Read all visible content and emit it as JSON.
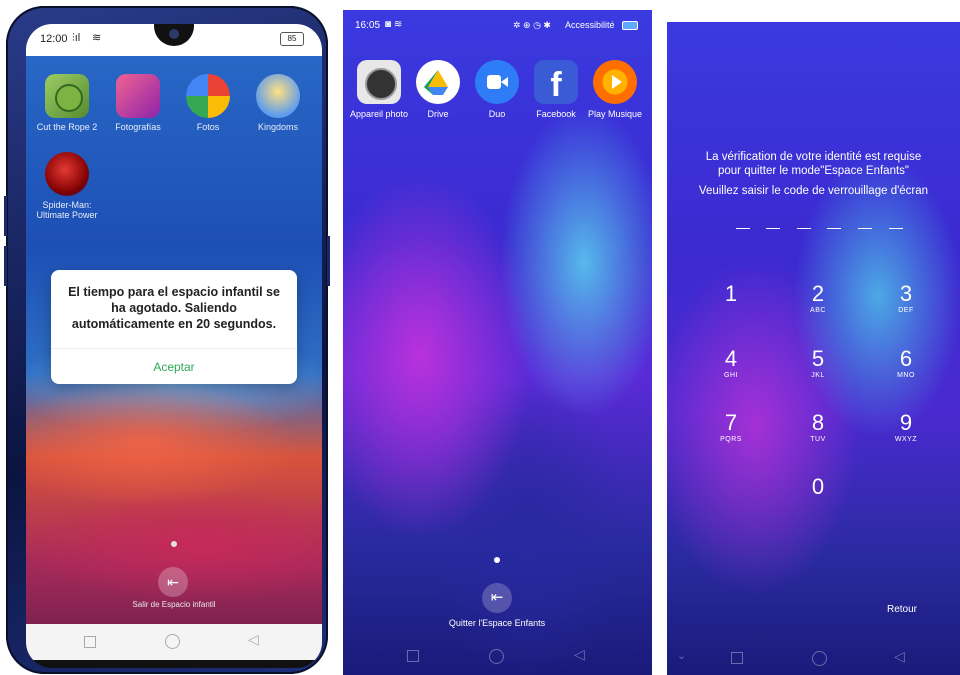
{
  "screen1": {
    "status_time": "12:00",
    "battery": "85",
    "apps": [
      {
        "label": "Cut the Rope 2",
        "icon": "cut-the-rope-2-icon",
        "color": "#8bc34a"
      },
      {
        "label": "Fotografías",
        "icon": "photos-gallery-icon",
        "color": "#d94a8c"
      },
      {
        "label": "Fotos",
        "icon": "google-photos-icon",
        "color": "#f2f2f2"
      },
      {
        "label": "Kingdoms",
        "icon": "kingdoms-icon",
        "color": "#e0c35a"
      },
      {
        "label": "Spider-Man: Ultimate Power",
        "icon": "spiderman-icon",
        "color": "#b71c1c"
      }
    ],
    "dialog": {
      "message": "El tiempo para el espacio infantil se ha agotado. Saliendo automáticamente en 20 segundos.",
      "button": "Aceptar"
    },
    "exit_label": "Salir de Espacio infantil",
    "accent": "#2fa85a"
  },
  "screen2": {
    "status_time": "16:05",
    "status_right": "Accessibilité",
    "apps": [
      {
        "label": "Appareil photo",
        "icon": "camera-icon",
        "color": "#e0e0e0"
      },
      {
        "label": "Drive",
        "icon": "google-drive-icon",
        "color": "#ffffff"
      },
      {
        "label": "Duo",
        "icon": "duo-icon",
        "color": "#2f7df6"
      },
      {
        "label": "Facebook",
        "icon": "facebook-icon",
        "color": "#3b5bd6"
      },
      {
        "label": "Play Musique",
        "icon": "play-music-icon",
        "color": "#ff6f00"
      }
    ],
    "exit_label": "Quitter l'Espace Enfants"
  },
  "screen3": {
    "prompt_line1": "La vérification de votre identité est requise",
    "prompt_line2": "pour quitter le mode\"Espace Enfants\"",
    "prompt_line3": "Veuillez saisir le code de verrouillage d'écran",
    "keys": [
      {
        "num": "1",
        "sub": ""
      },
      {
        "num": "2",
        "sub": "ABC"
      },
      {
        "num": "3",
        "sub": "DEF"
      },
      {
        "num": "4",
        "sub": "GHI"
      },
      {
        "num": "5",
        "sub": "JKL"
      },
      {
        "num": "6",
        "sub": "MNO"
      },
      {
        "num": "7",
        "sub": "PQRS"
      },
      {
        "num": "8",
        "sub": "TUV"
      },
      {
        "num": "9",
        "sub": "WXYZ"
      },
      {
        "num": "0",
        "sub": ""
      }
    ],
    "back_label": "Retour"
  }
}
